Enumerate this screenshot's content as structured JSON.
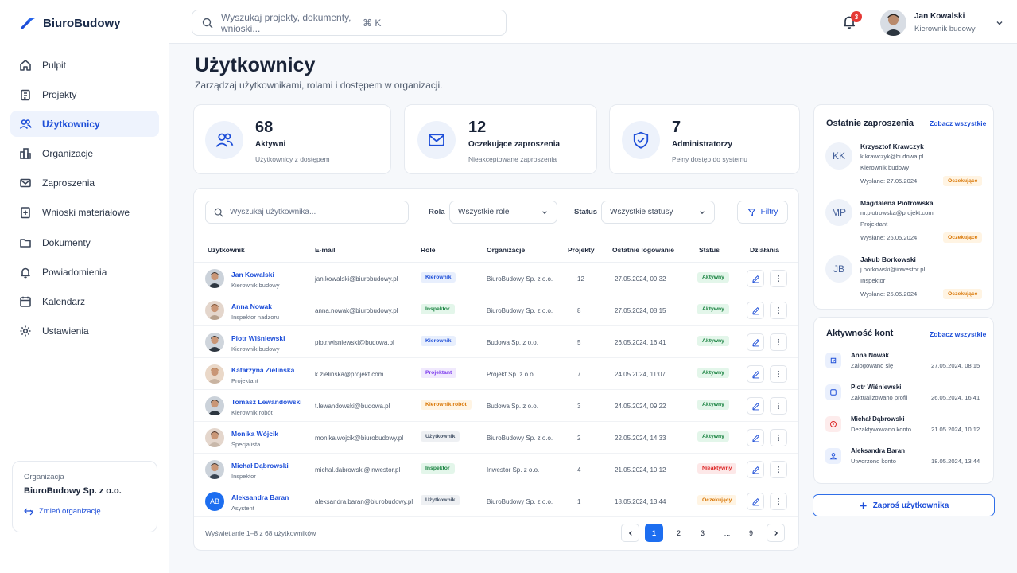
{
  "app": {
    "name": "BiuroBudowy"
  },
  "sidebar": {
    "items": [
      {
        "label": "Pulpit",
        "icon": "home-icon"
      },
      {
        "label": "Projekty",
        "icon": "clipboard-icon"
      },
      {
        "label": "Użytkownicy",
        "icon": "users-icon",
        "active": true
      },
      {
        "label": "Organizacje",
        "icon": "building-icon"
      },
      {
        "label": "Zaproszenia",
        "icon": "mail-icon"
      },
      {
        "label": "Wnioski materiałowe",
        "icon": "document-plus-icon"
      },
      {
        "label": "Dokumenty",
        "icon": "folder-icon"
      },
      {
        "label": "Powiadomienia",
        "icon": "bell-icon"
      },
      {
        "label": "Kalendarz",
        "icon": "calendar-icon"
      },
      {
        "label": "Ustawienia",
        "icon": "gear-icon"
      }
    ],
    "org": {
      "label": "Organizacja",
      "name": "BiuroBudowy Sp. z o.o.",
      "change": "Zmień organizację"
    }
  },
  "header": {
    "search_placeholder": "Wyszukaj projekty, dokumenty, wnioski...",
    "shortcut": "⌘ K",
    "notifications": "3",
    "user": {
      "name": "Jan Kowalski",
      "role": "Kierownik budowy"
    }
  },
  "page": {
    "title": "Użytkownicy",
    "subtitle": "Zarządzaj użytkownikami, rolami i dostępem w organizacji."
  },
  "stats": [
    {
      "value": "68",
      "label": "Aktywni",
      "desc": "Użytkownicy z dostępem"
    },
    {
      "value": "12",
      "label": "Oczekujące zaproszenia",
      "desc": "Nieakceptowane zaproszenia"
    },
    {
      "value": "7",
      "label": "Administratorzy",
      "desc": "Pełny dostęp do systemu"
    }
  ],
  "table": {
    "search_placeholder": "Wyszukaj użytkownika...",
    "role_label": "Rola",
    "role_value": "Wszystkie role",
    "status_label": "Status",
    "status_value": "Wszystkie statusy",
    "filters": "Filtry",
    "columns": [
      "Użytkownik",
      "E-mail",
      "Role",
      "Organizacje",
      "Projekty",
      "Ostatnie logowanie",
      "Status",
      "Działania"
    ],
    "rows": [
      {
        "name": "Jan Kowalski",
        "title": "Kierownik budowy",
        "email": "jan.kowalski@biurobudowy.pl",
        "role": "Kierownik",
        "org": "BiuroBudowy Sp. z o.o.",
        "projects": "12",
        "login": "27.05.2024, 09:32",
        "status": "Aktywny"
      },
      {
        "name": "Anna Nowak",
        "title": "Inspektor nadzoru",
        "email": "anna.nowak@biurobudowy.pl",
        "role": "Inspektor",
        "org": "BiuroBudowy Sp. z o.o.",
        "projects": "8",
        "login": "27.05.2024, 08:15",
        "status": "Aktywny"
      },
      {
        "name": "Piotr Wiśniewski",
        "title": "Kierownik budowy",
        "email": "piotr.wisniewski@budowa.pl",
        "role": "Kierownik",
        "org": "Budowa Sp. z o.o.",
        "projects": "5",
        "login": "26.05.2024, 16:41",
        "status": "Aktywny"
      },
      {
        "name": "Katarzyna Zielińska",
        "title": "Projektant",
        "email": "k.zielinska@projekt.com",
        "role": "Projektant",
        "org": "Projekt Sp. z o.o.",
        "projects": "7",
        "login": "24.05.2024, 11:07",
        "status": "Aktywny"
      },
      {
        "name": "Tomasz Lewandowski",
        "title": "Kierownik robót",
        "email": "t.lewandowski@budowa.pl",
        "role": "Kierownik robót",
        "org": "Budowa Sp. z o.o.",
        "projects": "3",
        "login": "24.05.2024, 09:22",
        "status": "Aktywny"
      },
      {
        "name": "Monika Wójcik",
        "title": "Specjalista",
        "email": "monika.wojcik@biurobudowy.pl",
        "role": "Użytkownik",
        "org": "BiuroBudowy Sp. z o.o.",
        "projects": "2",
        "login": "22.05.2024, 14:33",
        "status": "Aktywny"
      },
      {
        "name": "Michał Dąbrowski",
        "title": "Inspektor",
        "email": "michal.dabrowski@inwestor.pl",
        "role": "Inspektor",
        "org": "Inwestor Sp. z o.o.",
        "projects": "4",
        "login": "21.05.2024, 10:12",
        "status": "Nieaktywny"
      },
      {
        "name": "Aleksandra Baran",
        "title": "Asystent",
        "email": "aleksandra.baran@biurobudowy.pl",
        "role": "Użytkownik",
        "org": "BiuroBudowy Sp. z o.o.",
        "projects": "1",
        "login": "18.05.2024, 13:44",
        "status": "Oczekujący",
        "initials": "AB"
      }
    ],
    "footer": "Wyświetlanie 1–8 z 68 użytkowników",
    "pages": [
      "1",
      "2",
      "3",
      "...",
      "9"
    ]
  },
  "invites": {
    "title": "Ostatnie zaproszenia",
    "link": "Zobacz wszystkie",
    "items": [
      {
        "initials": "KK",
        "name": "Krzysztof Krawczyk",
        "email": "k.krawczyk@budowa.pl",
        "role": "Kierownik budowy",
        "sent": "Wysłane: 27.05.2024",
        "status": "Oczekujące"
      },
      {
        "initials": "MP",
        "name": "Magdalena Piotrowska",
        "email": "m.piotrowska@projekt.com",
        "role": "Projektant",
        "sent": "Wysłane: 26.05.2024",
        "status": "Oczekujące"
      },
      {
        "initials": "JB",
        "name": "Jakub Borkowski",
        "email": "j.borkowski@inwestor.pl",
        "role": "Inspektor",
        "sent": "Wysłane: 25.05.2024",
        "status": "Oczekujące"
      }
    ]
  },
  "activity": {
    "title": "Aktywność kont",
    "link": "Zobacz wszystkie",
    "items": [
      {
        "name": "Anna Nowak",
        "action": "Zalogowano się",
        "time": "27.05.2024, 08:15",
        "icon": "login-icon"
      },
      {
        "name": "Piotr Wiśniewski",
        "action": "Zaktualizowano profil",
        "time": "26.05.2024, 16:41",
        "icon": "edit-profile-icon"
      },
      {
        "name": "Michał Dąbrowski",
        "action": "Dezaktywowano konto",
        "time": "21.05.2024, 10:12",
        "icon": "deactivate-icon"
      },
      {
        "name": "Aleksandra Baran",
        "action": "Utworzono konto",
        "time": "18.05.2024, 13:44",
        "icon": "user-add-icon"
      }
    ]
  },
  "invite_button": "Zaproś użytkownika",
  "colors": {
    "accent": "#1d6ef0",
    "active_bg": "#eef3fd",
    "success": "#16a34a",
    "danger": "#dc2626",
    "warning": "#d97706"
  }
}
